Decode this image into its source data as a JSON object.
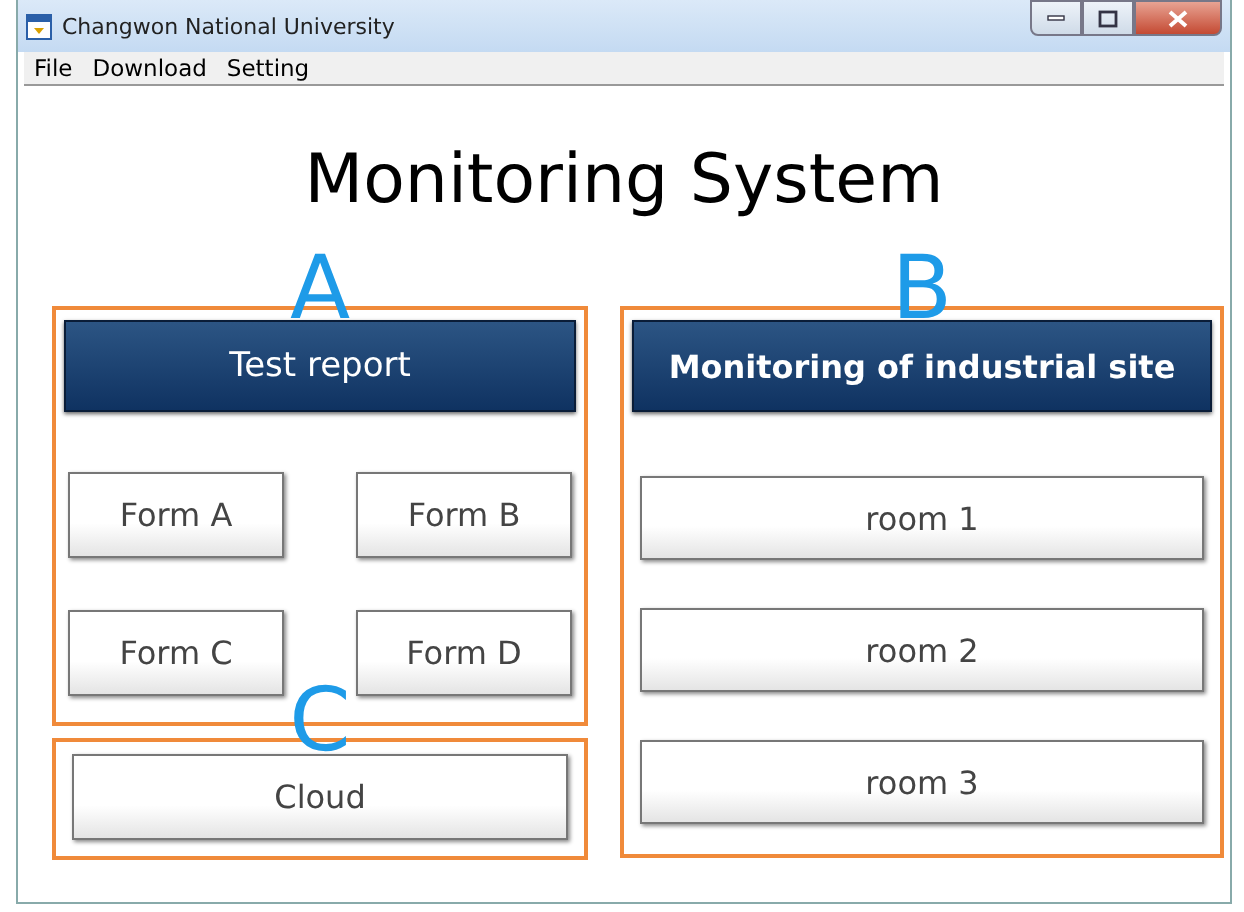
{
  "window": {
    "title": "Changwon National University"
  },
  "menu": [
    "File",
    "Download",
    "Setting"
  ],
  "heading": "Monitoring System",
  "sections": [
    {
      "kind": "forms",
      "label": "A",
      "header": "Test report",
      "buttons": [
        "Form A",
        "Form B",
        "Form C",
        "Form D"
      ]
    },
    {
      "kind": "single",
      "label": "C",
      "buttons": [
        "Cloud"
      ]
    },
    {
      "kind": "list",
      "label": "B",
      "header": "Monitoring of industrial site",
      "buttons": [
        "room 1",
        "room 2",
        "room 3"
      ]
    }
  ]
}
